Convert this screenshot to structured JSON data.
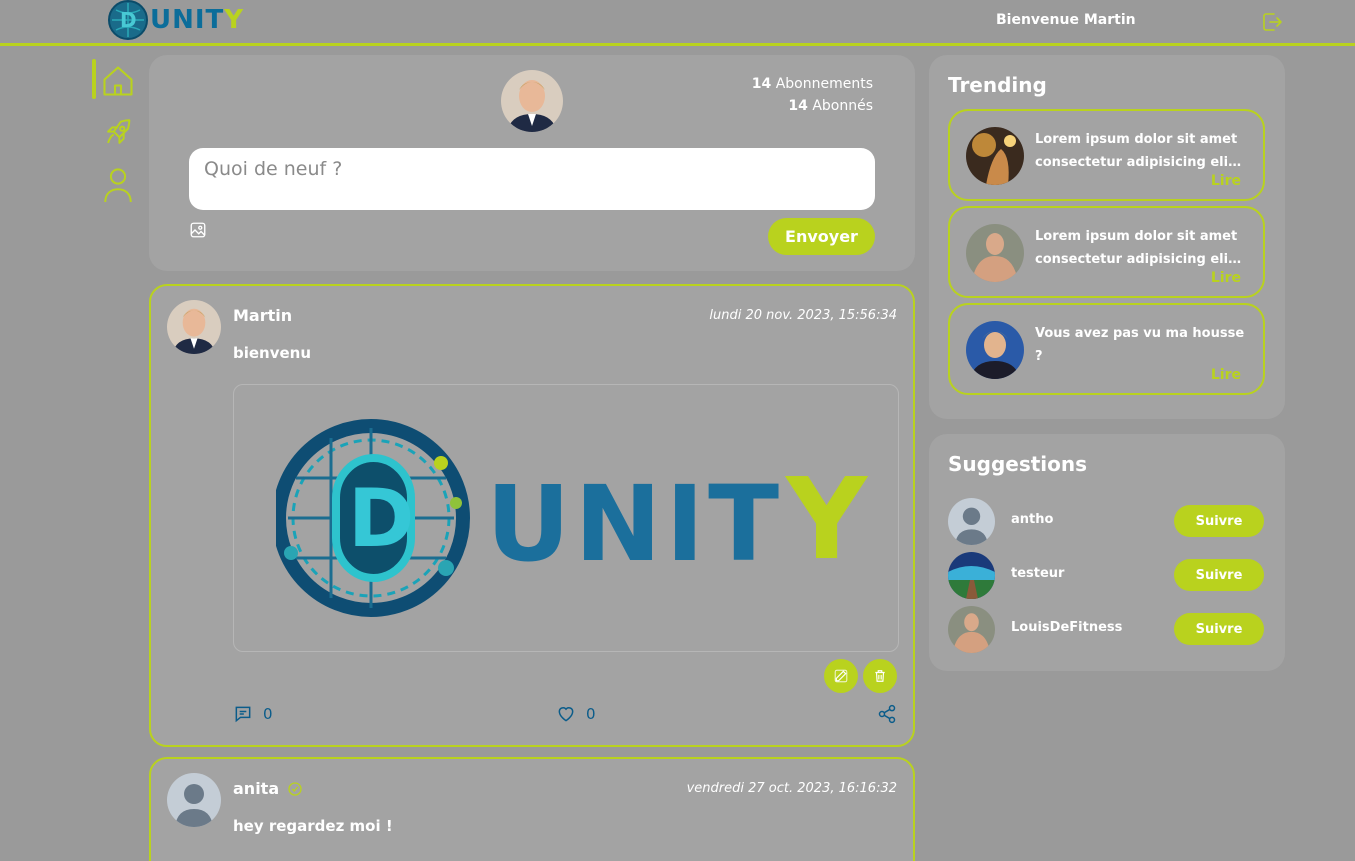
{
  "header": {
    "brand_unit": "UNIT",
    "brand_y": "Y",
    "welcome": "Bienvenue Martin"
  },
  "nav": {
    "items": [
      "home-icon",
      "rocket-icon",
      "user-icon"
    ],
    "active": 0
  },
  "composer": {
    "following_count": "14",
    "following_label": "Abonnements",
    "followers_count": "14",
    "followers_label": "Abonnés",
    "placeholder": "Quoi de neuf ?",
    "send_label": "Envoyer"
  },
  "posts": [
    {
      "author": "Martin",
      "date": "lundi 20 nov. 2023, 15:56:34",
      "text": "bienvenu",
      "image_brand": "UNIT",
      "image_brand_y": "Y",
      "comments": "0",
      "likes": "0"
    },
    {
      "author": "anita",
      "date": "vendredi 27 oct. 2023, 16:16:32",
      "text": "hey regardez moi !"
    }
  ],
  "trending": {
    "title": "Trending",
    "items": [
      {
        "text": "Lorem ipsum dolor sit amet consectetur adipisicing elit. Quisquam, voluptatum.",
        "link": "Lire"
      },
      {
        "text": "Lorem ipsum dolor sit amet consectetur adipisicing elit. Et, quisquam voluptatum.",
        "link": "Lire"
      },
      {
        "text": "Vous avez pas vu ma housse ?",
        "link": "Lire"
      }
    ]
  },
  "suggestions": {
    "title": "Suggestions",
    "follow_label": "Suivre",
    "users": [
      {
        "name": "antho"
      },
      {
        "name": "testeur"
      },
      {
        "name": "LouisDeFitness"
      }
    ]
  },
  "colors": {
    "accent": "#b9d21e",
    "background": "#9a9a9a",
    "card": "#a3a3a3",
    "icon_blue": "#0b5c8a"
  }
}
